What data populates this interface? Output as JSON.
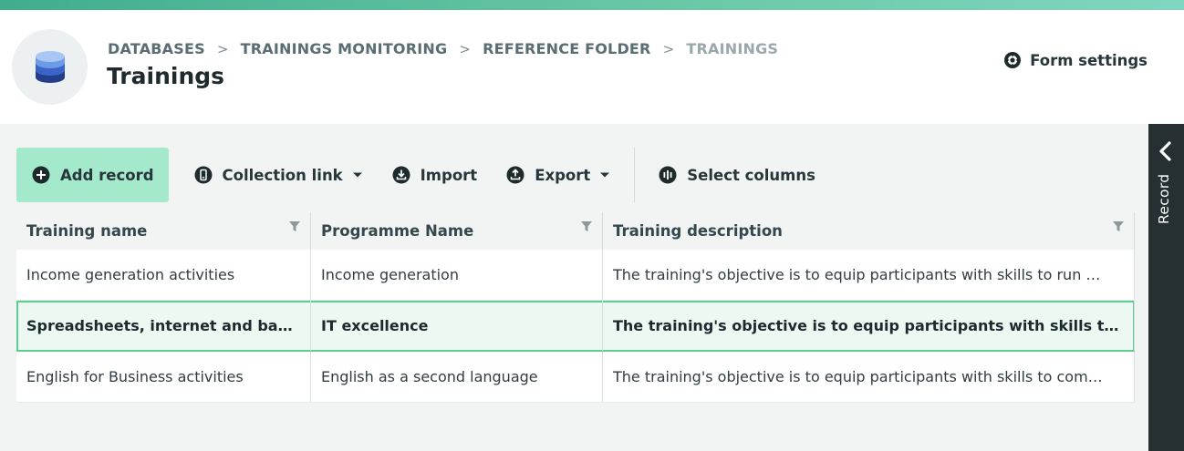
{
  "breadcrumb": {
    "items": [
      "DATABASES",
      "TRAININGS MONITORING",
      "REFERENCE FOLDER",
      "TRAININGS"
    ]
  },
  "page": {
    "title": "Trainings"
  },
  "header": {
    "form_settings_label": "Form settings"
  },
  "toolbar": {
    "add_record": "Add record",
    "collection_link": "Collection link",
    "import": "Import",
    "export": "Export",
    "select_columns": "Select columns"
  },
  "table": {
    "columns": [
      "Training name",
      "Programme Name",
      "Training description"
    ],
    "rows": [
      {
        "training_name": "Income generation activities",
        "programme_name": "Income generation",
        "description": "The training's objective is to equip participants with skills to run …"
      },
      {
        "training_name": "Spreadsheets, internet and basi…",
        "programme_name": "IT excellence",
        "description": "The training's objective is to equip participants with skills to b…",
        "selected": true
      },
      {
        "training_name": "English for Business activities",
        "programme_name": "English as a second language",
        "description": "The training's objective is to equip participants with skills to com…"
      }
    ]
  },
  "side_panel": {
    "label": "Record"
  },
  "colors": {
    "accent": "#a4e9cb",
    "selected_row_border": "#5fcd8f",
    "selected_row_bg": "#ebf9f2",
    "side_panel_bg": "#262f31"
  },
  "icons": [
    "database-icon",
    "gear-icon",
    "plus-circle-icon",
    "link-icon",
    "import-icon",
    "export-icon",
    "columns-icon",
    "filter-icon",
    "chevron-left-icon",
    "caret-down-icon"
  ]
}
